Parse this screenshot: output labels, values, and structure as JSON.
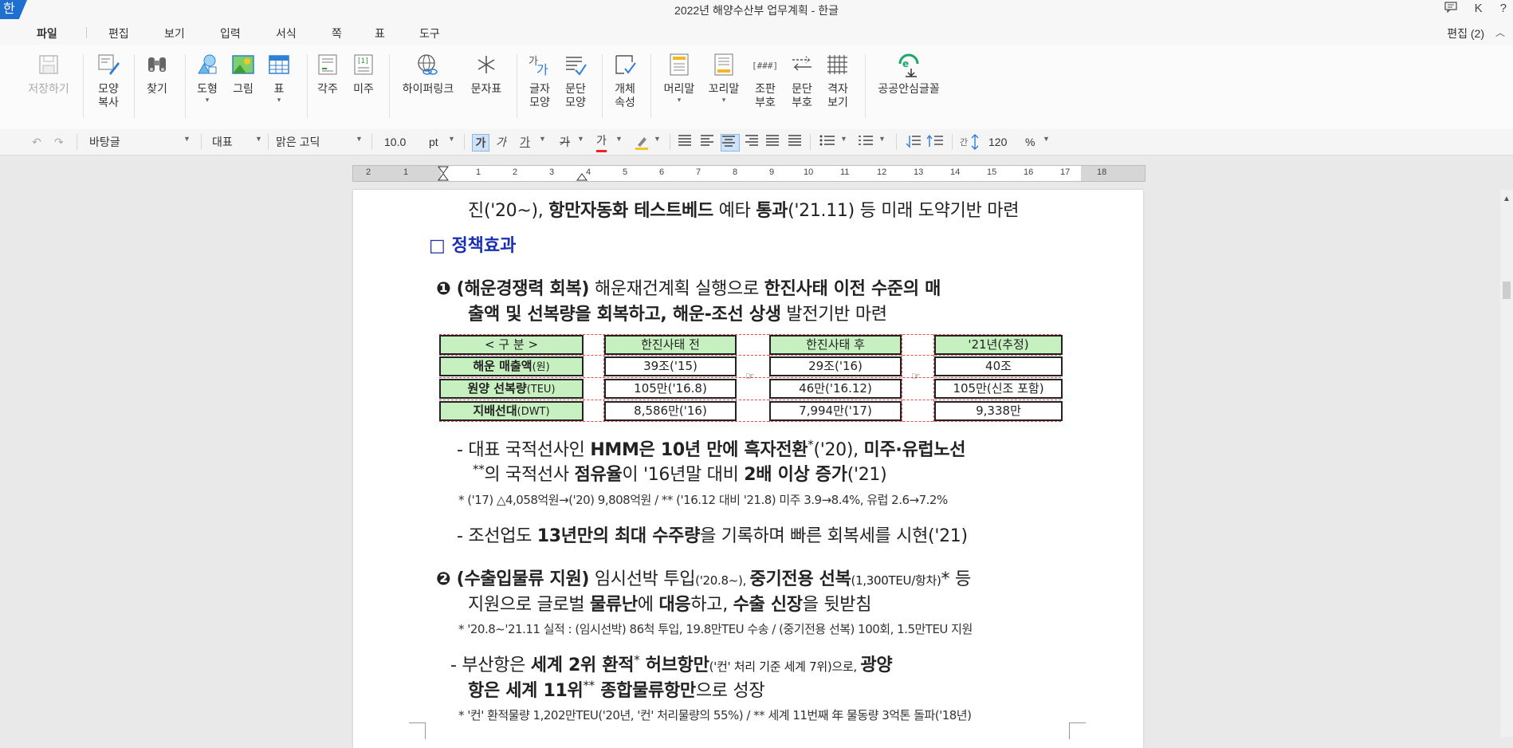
{
  "window": {
    "title": "2022년 해양수산부 업무계획 - 한글",
    "app_icon": "한",
    "right_icons": [
      "comment-icon",
      "K",
      "?"
    ]
  },
  "menu": {
    "items": [
      "파일",
      "편집",
      "보기",
      "입력",
      "서식",
      "쪽",
      "표",
      "도구"
    ],
    "active": "파일",
    "edit_mode": "편집 (2)"
  },
  "ribbon": {
    "save": "저장하기",
    "shape_copy": "모양\n복사",
    "find": "찾기",
    "shapes": "도형",
    "picture": "그림",
    "table": "표",
    "footnote": "각주",
    "endnote": "미주",
    "hyperlink": "하이퍼링크",
    "char_table": "문자표",
    "char_shape": "글자\n모양",
    "para_shape": "문단\n모양",
    "obj_props": "개체\n속성",
    "header": "머리말",
    "footer": "꼬리말",
    "typeset_marks": "조판\n부호",
    "para_marks": "문단\n부호",
    "grid_view": "격자\n보기",
    "public_font": "공공안심글꼴"
  },
  "format_bar": {
    "style": "바탕글",
    "lang": "대표",
    "font": "맑은 고딕",
    "size": "10.0",
    "size_unit": "pt",
    "bold": "가",
    "italic": "가",
    "underline": "가",
    "strike": "가",
    "font_color": "가",
    "line_spacing": "120",
    "line_spacing_unit": "%"
  },
  "ruler": {
    "numbers": [
      "2",
      "1",
      "1",
      "2",
      "3",
      "4",
      "5",
      "6",
      "7",
      "8",
      "9",
      "10",
      "11",
      "12",
      "13",
      "14",
      "15",
      "16",
      "17",
      "18"
    ]
  },
  "doc": {
    "line0_a": "진('20~), ",
    "line0_b": "항만자동화 테스트베드",
    "line0_c": " 예타 ",
    "line0_d": "통과",
    "line0_e": "('21.11) 등 미래 도약기반 마련",
    "section_header": "□ 정책효과",
    "item1_l1_a": "❶ (해운경쟁력 회복)",
    "item1_l1_b": " 해운재건계획 실행으로 ",
    "item1_l1_c": "한진사태 이전 수준의 매",
    "item1_l2_a": "출액 및 선복량을 회복하고, 해운-조선 상생",
    "item1_l2_b": " 발전기반 마련",
    "table": {
      "header": [
        "< 구   분 >",
        "한진사태 전",
        "한진사태 후",
        "'21년(추정)"
      ],
      "rows": [
        {
          "label": "해운 매출액",
          "unit": "(원)",
          "before": "39조('15)",
          "after": "29조('16)",
          "y21": "40조"
        },
        {
          "label": "원양 선복량",
          "unit": "(TEU)",
          "before": "105만('16.8)",
          "after": "46만('16.12)",
          "y21": "105만(신조 포함)"
        },
        {
          "label": "지배선대",
          "unit": "(DWT)",
          "before": "8,586만('16)",
          "after": "7,994만('17)",
          "y21": "9,338만"
        }
      ],
      "arrow": "☞"
    },
    "b1_l1_a": "- 대표 국적선사인 ",
    "b1_l1_b": "HMM은 10년 만에 흑자전환",
    "b1_l1_sup": "*",
    "b1_l1_c": "('20), ",
    "b1_l1_d": "미주·유럽노선",
    "b1_l2_a": "**",
    "b1_l2_b": "의 국적선사 ",
    "b1_l2_c": "점유율",
    "b1_l2_d": "이 '16년말 대비 ",
    "b1_l2_e": "2배 이상 증가",
    "b1_l2_f": "('21)",
    "note1": "* ('17) △4,058억원→('20) 9,808억원 / ** ('16.12 대비 '21.8) 미주 3.9→8.4%, 유럽 2.6→7.2%",
    "b2_a": "- 조선업도 ",
    "b2_b": "13년만의 최대 수주량",
    "b2_c": "을 기록하며 빠른 회복세를 시현('21)",
    "item2_l1_a": "❷ (수출입물류 지원)",
    "item2_l1_b": " 임시선박 투입",
    "item2_l1_c": "('20.8~), ",
    "item2_l1_d": "중기전용 선복",
    "item2_l1_e": "(1,300TEU/항차)",
    "item2_l1_f": "* 등",
    "item2_l2_a": "지원으로 글로벌 ",
    "item2_l2_b": "물류난",
    "item2_l2_c": "에 ",
    "item2_l2_d": "대응",
    "item2_l2_e": "하고, ",
    "item2_l2_f": "수출 신장",
    "item2_l2_g": "을 뒷받침",
    "note2": "* '20.8~'21.11 실적 : (임시선박) 86척 투입, 19.8만TEU 수송 / (중기전용 선복) 100회, 1.5만TEU 지원",
    "b3_l1_a": "- 부산항은 ",
    "b3_l1_b": "세계 2위 환적",
    "b3_l1_sup": "*",
    "b3_l1_c": " 허브항만",
    "b3_l1_d": "('컨' 처리 기준 세계 7위)으로, ",
    "b3_l1_e": "광양",
    "b3_l2_a": "항은 세계 11위",
    "b3_l2_sup": "**",
    "b3_l2_b": " 종합물류항만",
    "b3_l2_c": "으로 성장",
    "note3": "* '컨' 환적물량 1,202만TEU('20년, '컨' 처리물량의 55%) / ** 세계 11번째 年 물동량 3억톤 돌파('18년)"
  }
}
